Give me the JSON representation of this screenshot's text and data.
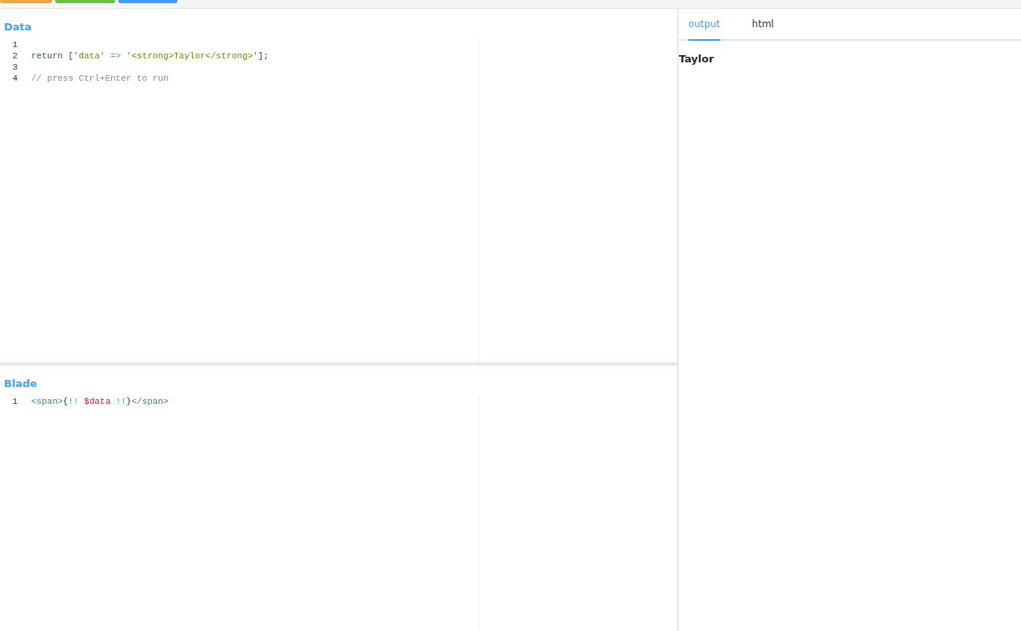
{
  "toolbar": {
    "buttons": [
      {
        "color": "#f0a53a"
      },
      {
        "color": "#67c23a"
      },
      {
        "color": "#409eff"
      }
    ]
  },
  "data_editor": {
    "title": "Data",
    "lines": [
      {
        "number": "1"
      },
      {
        "number": "2",
        "tokens": [
          {
            "kind": "keyword",
            "text": "return"
          },
          {
            "kind": "plain",
            "text": " ["
          },
          {
            "kind": "string",
            "text": "'data'"
          },
          {
            "kind": "operator",
            "text": " => "
          },
          {
            "kind": "string",
            "text": "'<strong>Taylor</strong>'"
          },
          {
            "kind": "plain",
            "text": "];"
          }
        ]
      },
      {
        "number": "3"
      },
      {
        "number": "4",
        "tokens": [
          {
            "kind": "comment",
            "text": "// press Ctrl+Enter to run"
          }
        ]
      }
    ]
  },
  "blade_editor": {
    "title": "Blade",
    "lines": [
      {
        "number": "1",
        "tokens": [
          {
            "kind": "tag",
            "text": "<span>"
          },
          {
            "kind": "plain",
            "text": "{"
          },
          {
            "kind": "operator",
            "text": "!! "
          },
          {
            "kind": "variable",
            "text": "$data"
          },
          {
            "kind": "operator",
            "text": " !!"
          },
          {
            "kind": "plain",
            "text": "}"
          },
          {
            "kind": "tag",
            "text": "</span>"
          }
        ]
      }
    ]
  },
  "output_panel": {
    "tabs": [
      {
        "label": "output",
        "selected": true
      },
      {
        "label": "html",
        "selected": false
      }
    ],
    "result": "Taylor"
  }
}
